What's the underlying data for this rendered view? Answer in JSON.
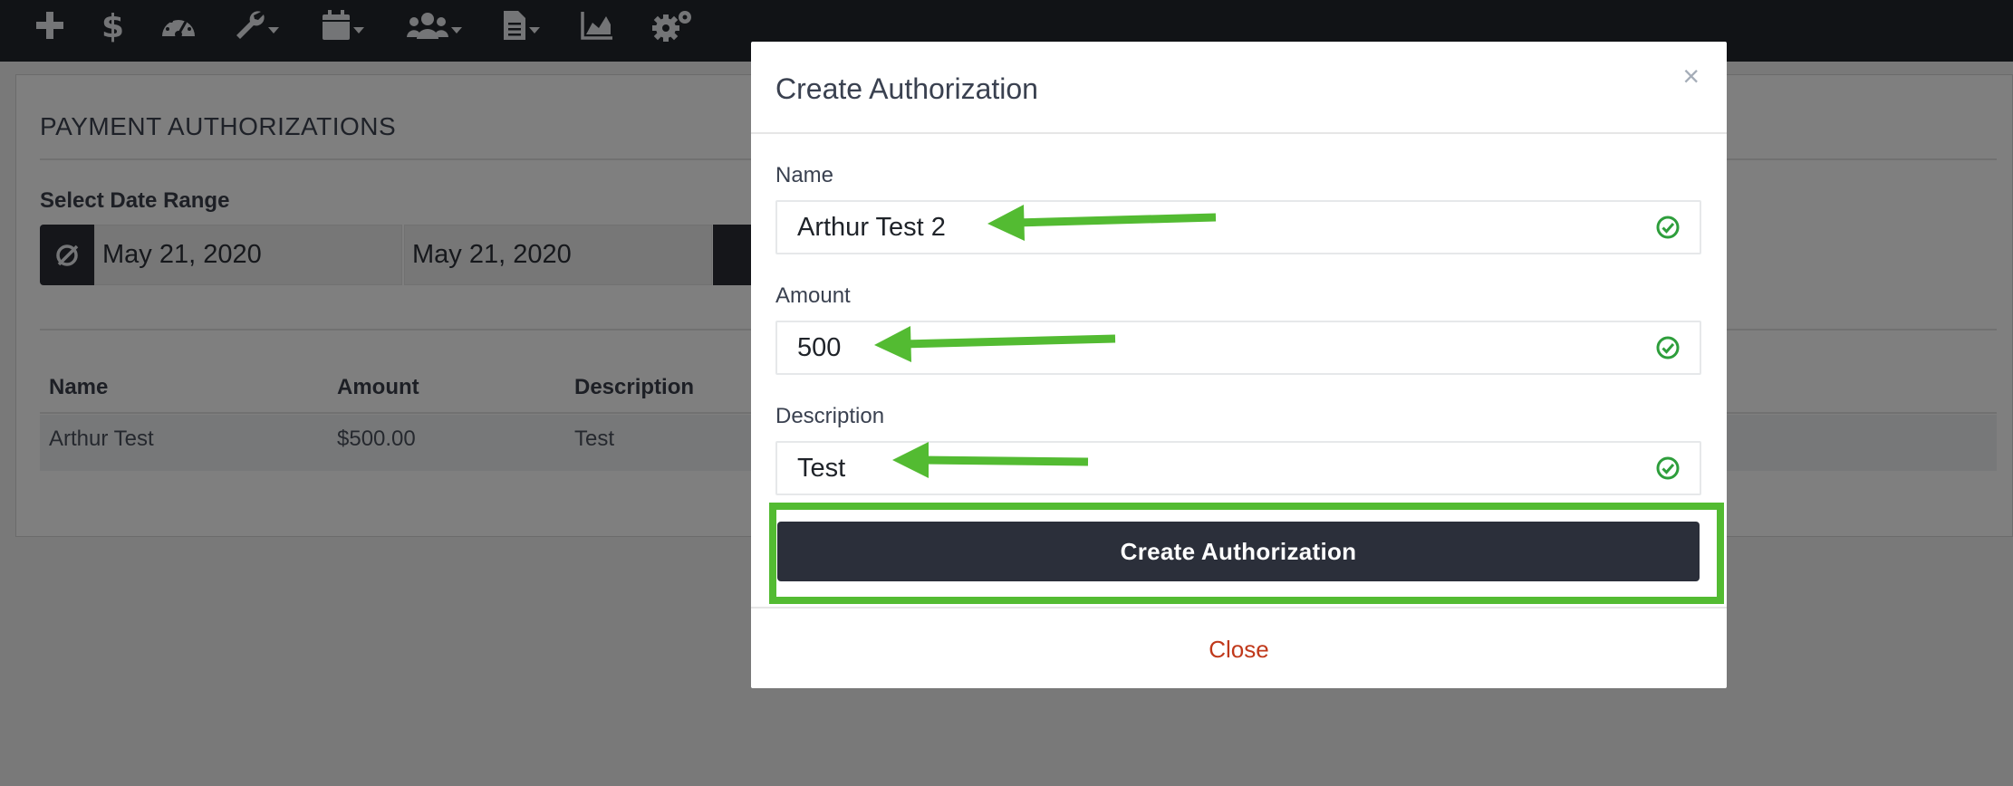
{
  "navbar": {
    "icons": [
      "plus-icon",
      "dollar-icon",
      "dashboard-gauge-icon",
      "wrench-icon",
      "calendar-icon",
      "users-icon",
      "document-icon",
      "area-chart-icon",
      "gears-icon"
    ],
    "dropdown_icons": [
      "wrench-icon",
      "calendar-icon",
      "users-icon",
      "document-icon"
    ]
  },
  "page": {
    "title": "PAYMENT AUTHORIZATIONS",
    "date_range_label": "Select Date Range",
    "start_date": "May 21, 2020",
    "end_date": "May 21, 2020",
    "table": {
      "columns": [
        "Name",
        "Amount",
        "Description"
      ],
      "rows": [
        {
          "name": "Arthur Test",
          "amount": "$500.00",
          "description": "Test"
        }
      ]
    }
  },
  "modal": {
    "title": "Create Authorization",
    "close_x": "×",
    "name_label": "Name",
    "name_value": "Arthur Test 2",
    "amount_label": "Amount",
    "amount_value": "500",
    "description_label": "Description",
    "description_value": "Test",
    "submit_label": "Create Authorization",
    "close_label": "Close"
  },
  "colors": {
    "navbar": "#23262c",
    "annotation_green": "#53bb32",
    "valid_check": "#2e9e3c",
    "close_link": "#c0391b",
    "button_dark": "#2b2f3a"
  }
}
